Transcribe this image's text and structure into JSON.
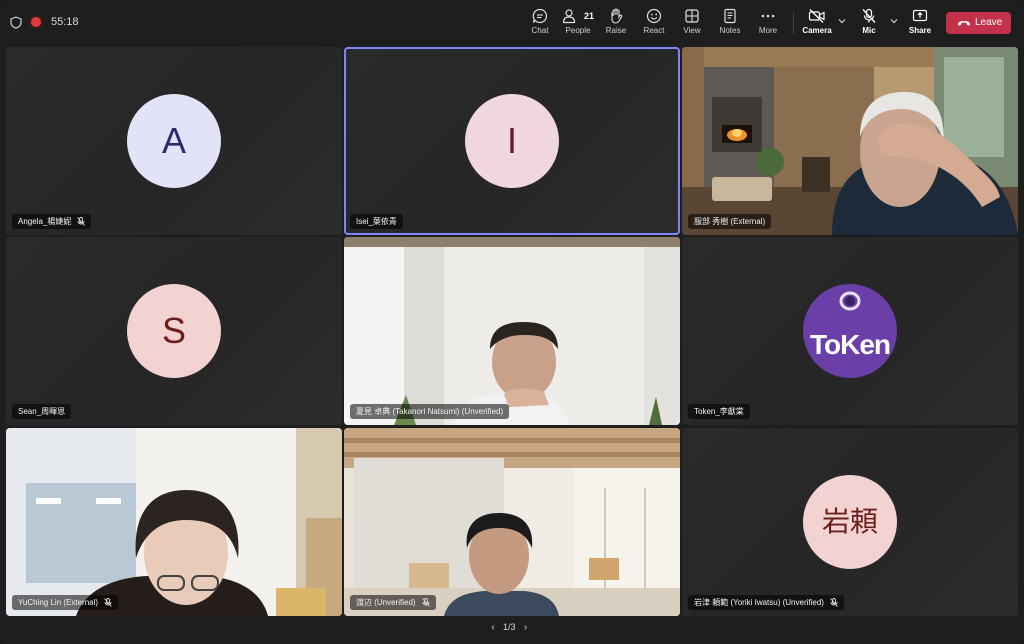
{
  "call": {
    "timer": "55:18"
  },
  "toolbar": {
    "chat": "Chat",
    "people": "People",
    "people_count": "21",
    "raise": "Raise",
    "react": "React",
    "view": "View",
    "notes": "Notes",
    "more": "More",
    "camera": "Camera",
    "mic": "Mic",
    "share": "Share",
    "leave": "Leave"
  },
  "participants": [
    {
      "name": "Angela_楊婕妮",
      "initial": "A",
      "avatar_bg": "#e3e3f7",
      "avatar_fg": "#2c2a6b"
    },
    {
      "name": "Isei_葉依青",
      "initial": "I",
      "avatar_bg": "#efd6e1",
      "avatar_fg": "#5a1f33"
    },
    {
      "name": "服部 秀樹 (External)"
    },
    {
      "name": "Sean_周暉恩",
      "initial": "S",
      "avatar_bg": "#f3d3d1",
      "avatar_fg": "#6a1f1a"
    },
    {
      "name": "夏見 卓典 (Takanori Natsumi) (Unverified)"
    },
    {
      "name": "Token_李獻棠"
    },
    {
      "name": "YuChing Lin (External)"
    },
    {
      "name": "渡辺 (Unverified)"
    },
    {
      "name": "岩津 頼範 (Yoriki Iwatsu) (Unverified)",
      "initial": "岩頼",
      "avatar_bg": "#f3d3d1",
      "avatar_fg": "#6a1f1a"
    }
  ],
  "token_logo_text": "ToKen",
  "pagination": {
    "label": "1/3"
  },
  "colors": {
    "leave": "#c4314b",
    "active_border": "#7f85f5",
    "recording": "#e23b3b"
  }
}
